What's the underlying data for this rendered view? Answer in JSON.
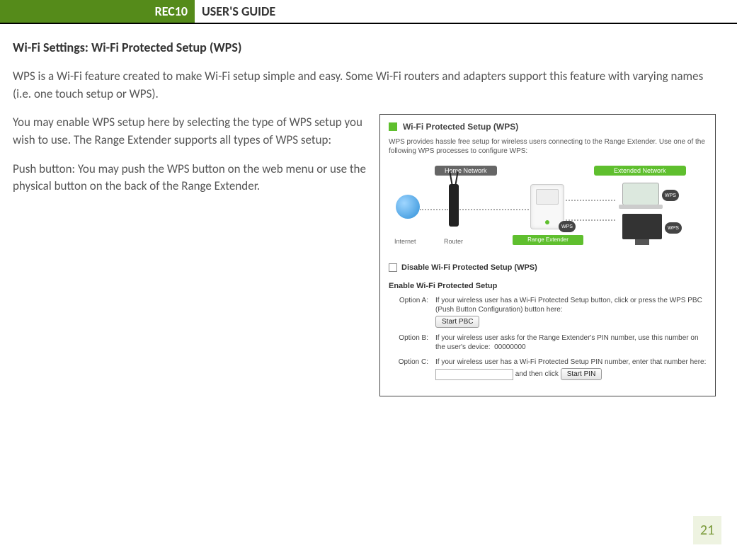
{
  "header": {
    "product": "REC10",
    "title": "USER'S GUIDE"
  },
  "section": {
    "heading": "Wi-Fi Settings: Wi-Fi Protected Setup (WPS)",
    "intro": "WPS is a Wi-Fi feature created to make Wi-Fi setup simple and easy.  Some Wi-Fi routers and adapters support this feature with varying names (i.e. one touch setup or WPS).",
    "p1": "You may enable WPS setup here by selecting the type of WPS setup you wish to use.  The Range Extender supports all types of WPS setup:",
    "p2": "Push button: You may push the WPS button on the web menu or use the physical button on the back of the Range Extender."
  },
  "panel": {
    "title": "Wi-Fi Protected Setup (WPS)",
    "desc": "WPS provides hassle free setup for wireless users connecting to the Range Extender. Use one of the following WPS processes to configure WPS:",
    "diagram": {
      "home_label": "Home Network",
      "ext_label": "Extended Network",
      "internet": "Internet",
      "router": "Router",
      "range_extender": "Range Extender",
      "wps_badge": "WPS"
    },
    "disable_label": "Disable Wi-Fi Protected Setup (WPS)",
    "enable_heading": "Enable Wi-Fi Protected Setup",
    "optA": {
      "label": "Option A:",
      "text": "If your wireless user has a Wi-Fi Protected Setup button, click or press the WPS PBC (Push Button Configuration) button here:",
      "button": "Start PBC"
    },
    "optB": {
      "label": "Option B:",
      "text": "If your wireless user asks for the Range Extender's PIN number, use this number on the user's device:",
      "pin": "00000000"
    },
    "optC": {
      "label": "Option C:",
      "text": "If your wireless user has a Wi-Fi Protected Setup PIN number, enter that number here:",
      "and_then": "and then click",
      "button": "Start PIN"
    }
  },
  "page_number": "21"
}
